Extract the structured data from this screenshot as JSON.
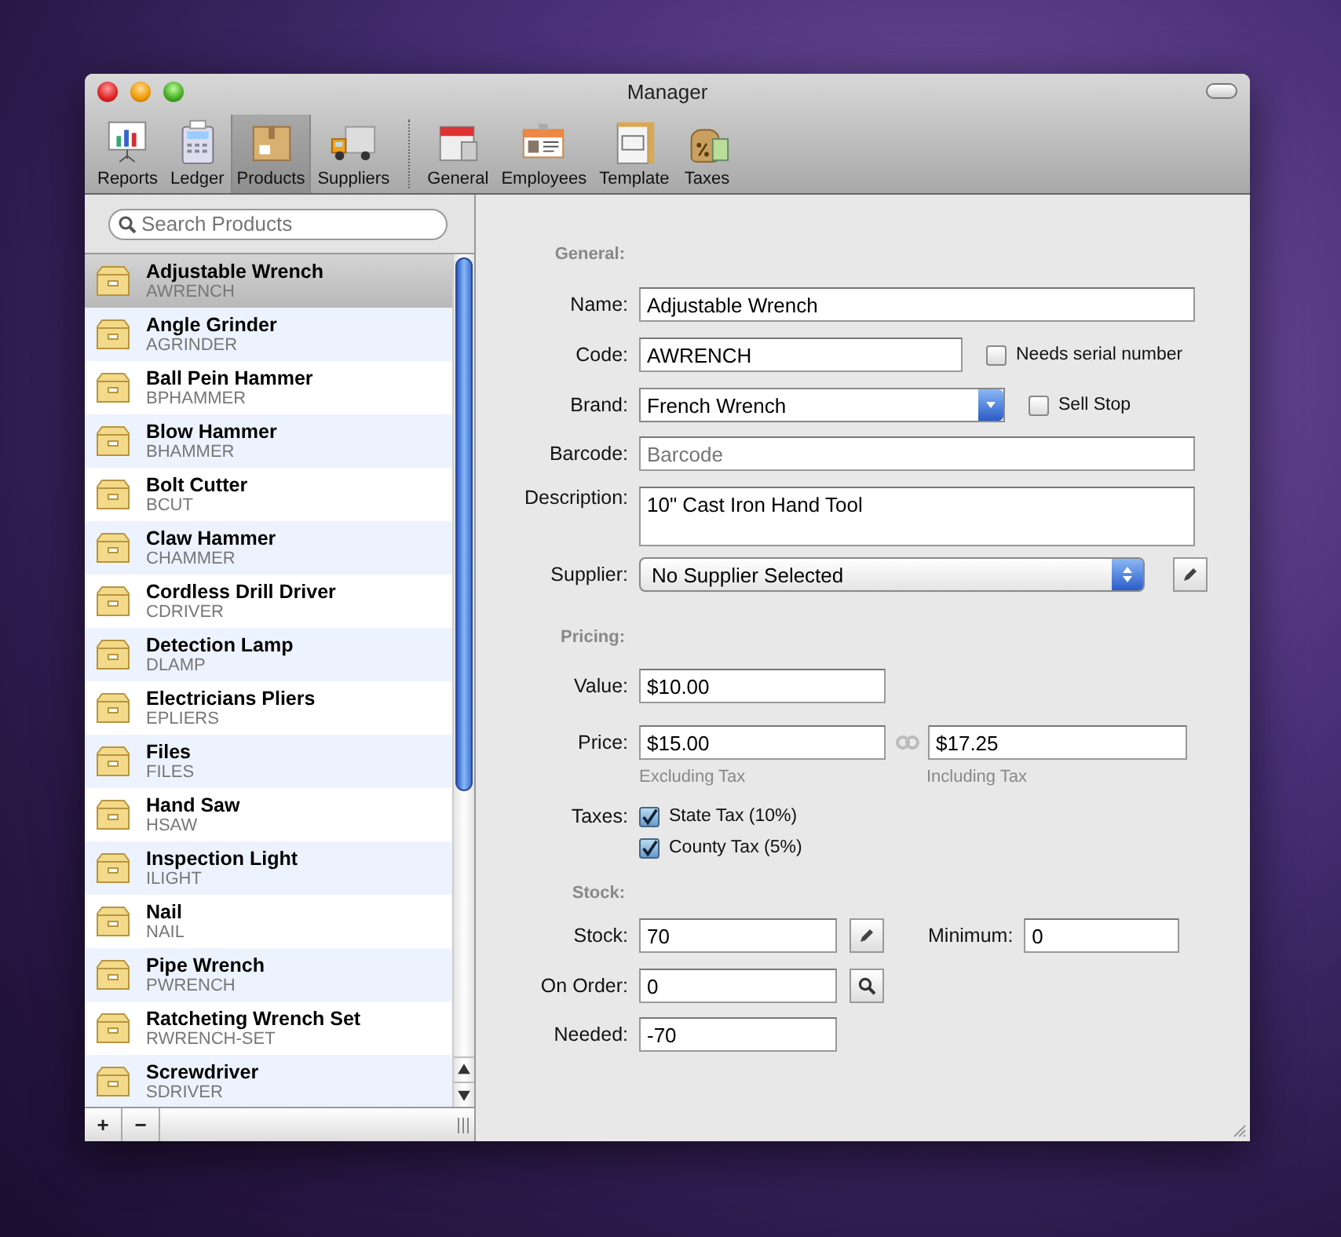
{
  "window": {
    "title": "Manager"
  },
  "toolbar": {
    "groups": [
      [
        {
          "label": "Reports",
          "selected": false
        },
        {
          "label": "Ledger",
          "selected": false
        },
        {
          "label": "Products",
          "selected": true
        },
        {
          "label": "Suppliers",
          "selected": false
        }
      ],
      [
        {
          "label": "General",
          "selected": false
        },
        {
          "label": "Employees",
          "selected": false
        },
        {
          "label": "Template",
          "selected": false
        },
        {
          "label": "Taxes",
          "selected": false
        }
      ]
    ]
  },
  "search": {
    "placeholder": "Search Products"
  },
  "products": [
    {
      "name": "Adjustable Wrench",
      "code": "AWRENCH",
      "selected": true
    },
    {
      "name": "Angle Grinder",
      "code": "AGRINDER",
      "selected": false
    },
    {
      "name": "Ball Pein Hammer",
      "code": "BPHAMMER",
      "selected": false
    },
    {
      "name": "Blow Hammer",
      "code": "BHAMMER",
      "selected": false
    },
    {
      "name": "Bolt Cutter",
      "code": "BCUT",
      "selected": false
    },
    {
      "name": "Claw Hammer",
      "code": "CHAMMER",
      "selected": false
    },
    {
      "name": "Cordless Drill Driver",
      "code": "CDRIVER",
      "selected": false
    },
    {
      "name": "Detection Lamp",
      "code": "DLAMP",
      "selected": false
    },
    {
      "name": "Electricians Pliers",
      "code": "EPLIERS",
      "selected": false
    },
    {
      "name": "Files",
      "code": "FILES",
      "selected": false
    },
    {
      "name": "Hand Saw",
      "code": "HSAW",
      "selected": false
    },
    {
      "name": "Inspection Light",
      "code": "ILIGHT",
      "selected": false
    },
    {
      "name": "Nail",
      "code": "NAIL",
      "selected": false
    },
    {
      "name": "Pipe Wrench",
      "code": "PWRENCH",
      "selected": false
    },
    {
      "name": "Ratcheting Wrench Set",
      "code": "RWRENCH-SET",
      "selected": false
    },
    {
      "name": "Screwdriver",
      "code": "SDRIVER",
      "selected": false
    }
  ],
  "list_buttons": [
    "+",
    "−"
  ],
  "general": {
    "heading": "General:",
    "name": {
      "label": "Name:",
      "value": "Adjustable Wrench"
    },
    "code": {
      "label": "Code:",
      "value": "AWRENCH"
    },
    "needs_serial": {
      "label": "Needs serial number",
      "checked": false
    },
    "brand": {
      "label": "Brand:",
      "value": "French Wrench"
    },
    "sell_stop": {
      "label": "Sell Stop",
      "checked": false
    },
    "barcode": {
      "label": "Barcode:",
      "placeholder": "Barcode"
    },
    "description": {
      "label": "Description:",
      "value": "10\" Cast Iron Hand Tool"
    },
    "supplier": {
      "label": "Supplier:",
      "value": "No Supplier Selected"
    }
  },
  "pricing": {
    "heading": "Pricing:",
    "value": {
      "label": "Value:",
      "value": "$10.00"
    },
    "price": {
      "label": "Price:",
      "value": "$15.00",
      "note": "Excluding Tax"
    },
    "price_incl": {
      "value": "$17.25",
      "note": "Including Tax"
    },
    "taxes": {
      "label": "Taxes:",
      "items": [
        {
          "label": "State Tax (10%)",
          "checked": true
        },
        {
          "label": "County Tax (5%)",
          "checked": true
        }
      ]
    }
  },
  "stock": {
    "heading": "Stock:",
    "stock": {
      "label": "Stock:",
      "value": "70"
    },
    "minimum": {
      "label": "Minimum:",
      "value": "0"
    },
    "on_order": {
      "label": "On Order:",
      "value": "0"
    },
    "needed": {
      "label": "Needed:",
      "value": "-70"
    }
  }
}
